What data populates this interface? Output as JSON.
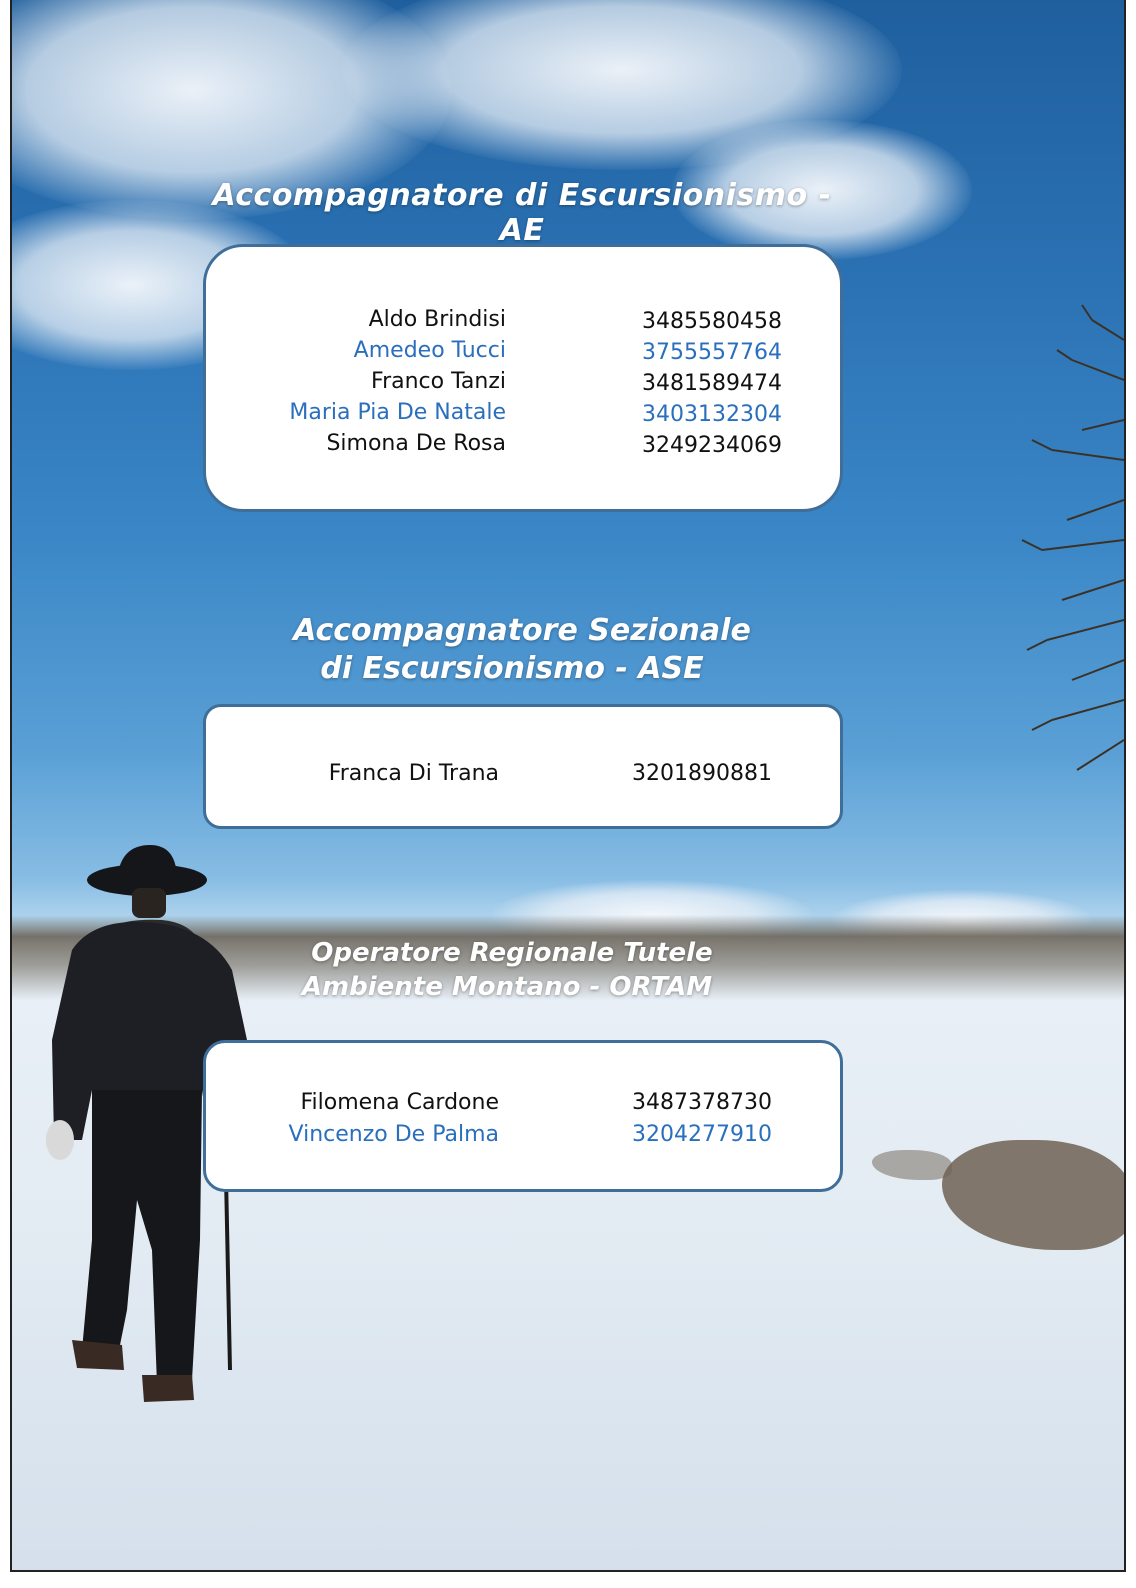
{
  "sections": [
    {
      "title": "Accompagnatore di Escursionismo - AE",
      "contacts": [
        {
          "name": "Aldo Brindisi",
          "phone": "3485580458",
          "color": "#111111"
        },
        {
          "name": "Amedeo Tucci",
          "phone": "3755557764",
          "color": "#2a6fbd"
        },
        {
          "name": "Franco Tanzi",
          "phone": "3481589474",
          "color": "#111111"
        },
        {
          "name": "Maria Pia De Natale",
          "phone": "3403132304",
          "color": "#2a6fbd"
        },
        {
          "name": "Simona De Rosa",
          "phone": "3249234069",
          "color": "#111111"
        }
      ]
    },
    {
      "title_line1": "Accompagnatore Sezionale",
      "title_line2": "di Escursionismo - ASE",
      "contacts": [
        {
          "name": "Franca Di Trana",
          "phone": "3201890881",
          "color": "#111111"
        }
      ]
    },
    {
      "title_line1": "Operatore Regionale Tutele",
      "title_line2": "Ambiente Montano - ORTAM",
      "contacts": [
        {
          "name": "Filomena Cardone",
          "phone": "3487378730",
          "color": "#111111"
        },
        {
          "name": "Vincenzo De Palma",
          "phone": "3204277910",
          "color": "#2a6fbd"
        }
      ]
    }
  ],
  "accent_blue": "#2a6fbd",
  "box_border": "#3f6e99"
}
